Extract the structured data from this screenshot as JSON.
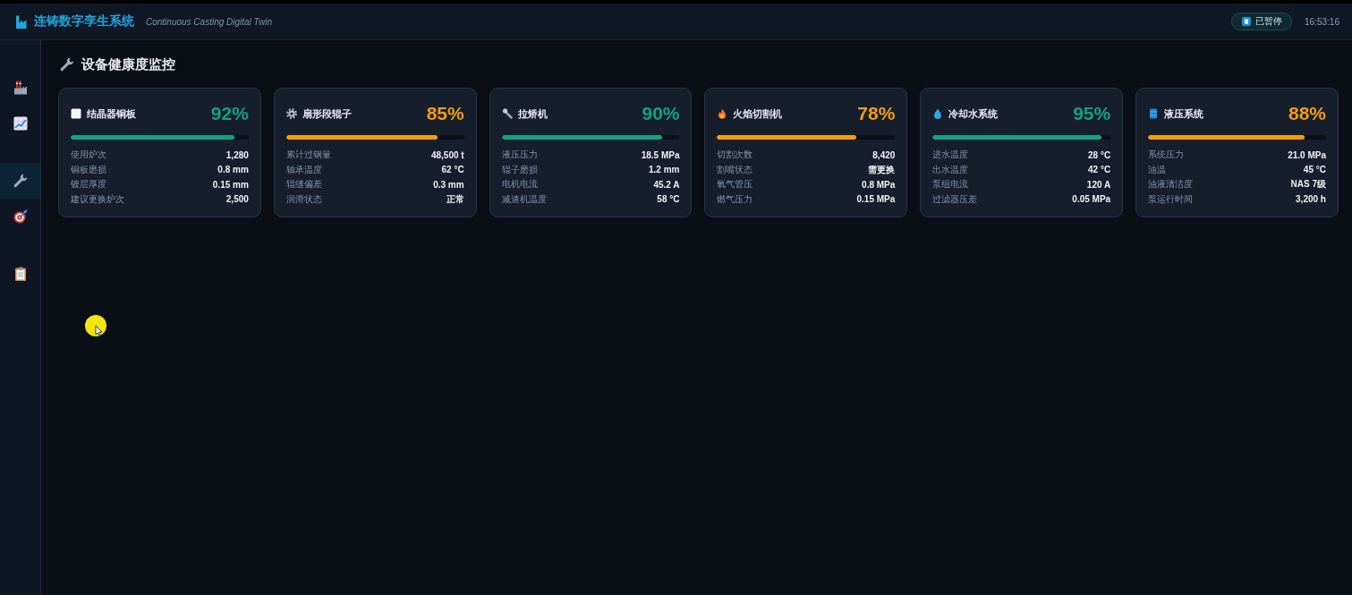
{
  "header": {
    "title": "连铸数字孪生系统",
    "subtitle": "Continuous Casting Digital Twin",
    "status": {
      "label": "已暂停"
    },
    "time": "16:53:16"
  },
  "sidebar": {
    "groups": [
      {
        "items": [
          {
            "selected": false
          },
          {
            "selected": false
          }
        ]
      },
      {
        "items": [
          {
            "selected": true
          },
          {
            "selected": false
          }
        ]
      },
      {
        "items": [
          {
            "selected": false
          }
        ]
      }
    ]
  },
  "page": {
    "title": "设备健康度监控"
  },
  "cards": [
    {
      "name": "结晶器铜板",
      "percent": "92%",
      "level": 0.92,
      "color": "#10a37f",
      "metrics": [
        {
          "label": "使用炉次",
          "value": "1,280"
        },
        {
          "label": "铜板磨损",
          "value": "0.8 mm"
        },
        {
          "label": "镀层厚度",
          "value": "0.15 mm"
        },
        {
          "label": "建议更换炉次",
          "value": "2,500"
        }
      ]
    },
    {
      "name": "扇形段辊子",
      "percent": "85%",
      "level": 0.85,
      "color": "#f59e0b",
      "metrics": [
        {
          "label": "累计过钢量",
          "value": "48,500 t"
        },
        {
          "label": "轴承温度",
          "value": "62 °C"
        },
        {
          "label": "辊缝偏差",
          "value": "0.3 mm"
        },
        {
          "label": "润滑状态",
          "value": "正常"
        }
      ]
    },
    {
      "name": "拉矫机",
      "percent": "90%",
      "level": 0.9,
      "color": "#10a37f",
      "metrics": [
        {
          "label": "液压压力",
          "value": "18.5 MPa"
        },
        {
          "label": "辊子磨损",
          "value": "1.2 mm"
        },
        {
          "label": "电机电流",
          "value": "45.2 A"
        },
        {
          "label": "减速机温度",
          "value": "58 °C"
        }
      ]
    },
    {
      "name": "火焰切割机",
      "percent": "78%",
      "level": 0.78,
      "color": "#f59e0b",
      "metrics": [
        {
          "label": "切割次数",
          "value": "8,420"
        },
        {
          "label": "割嘴状态",
          "value": "需更换"
        },
        {
          "label": "氧气管压",
          "value": "0.8 MPa"
        },
        {
          "label": "燃气压力",
          "value": "0.15 MPa"
        }
      ]
    },
    {
      "name": "冷却水系统",
      "percent": "95%",
      "level": 0.95,
      "color": "#10a37f",
      "metrics": [
        {
          "label": "进水温度",
          "value": "28 °C"
        },
        {
          "label": "出水温度",
          "value": "42 °C"
        },
        {
          "label": "泵组电流",
          "value": "120 A"
        },
        {
          "label": "过滤器压差",
          "value": "0.05 MPa"
        }
      ]
    },
    {
      "name": "液压系统",
      "percent": "88%",
      "level": 0.88,
      "color": "#f59e0b",
      "metrics": [
        {
          "label": "系统压力",
          "value": "21.0 MPa"
        },
        {
          "label": "油温",
          "value": "45 °C"
        },
        {
          "label": "油液清洁度",
          "value": "NAS 7级"
        },
        {
          "label": "泵运行时间",
          "value": "3,200 h"
        }
      ]
    }
  ]
}
